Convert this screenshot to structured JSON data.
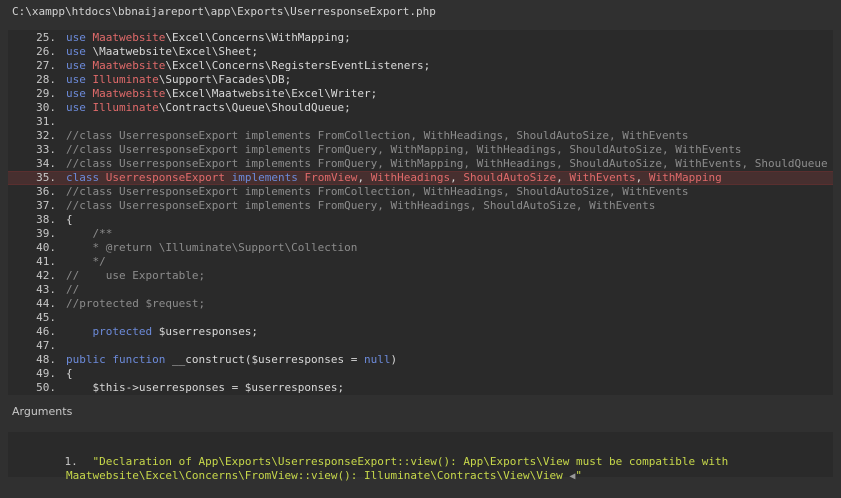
{
  "file_path": "C:\\xampp\\htdocs\\bbnaijareport\\app\\Exports\\UserresponseExport.php",
  "arguments_label": "Arguments",
  "code_lines": [
    {
      "n": "25.",
      "hl": false,
      "t": [
        [
          "k",
          "use "
        ],
        [
          "r",
          "Maatwebsite"
        ],
        [
          "w",
          "\\Excel\\Concerns\\WithMapping;"
        ]
      ]
    },
    {
      "n": "26.",
      "hl": false,
      "t": [
        [
          "k",
          "use "
        ],
        [
          "w",
          "\\Maatwebsite\\Excel\\Sheet;"
        ]
      ]
    },
    {
      "n": "27.",
      "hl": false,
      "t": [
        [
          "k",
          "use "
        ],
        [
          "r",
          "Maatwebsite"
        ],
        [
          "w",
          "\\Excel\\Concerns\\RegistersEventListeners;"
        ]
      ]
    },
    {
      "n": "28.",
      "hl": false,
      "t": [
        [
          "k",
          "use "
        ],
        [
          "r",
          "Illuminate"
        ],
        [
          "w",
          "\\Support\\Facades\\DB;"
        ]
      ]
    },
    {
      "n": "29.",
      "hl": false,
      "t": [
        [
          "k",
          "use "
        ],
        [
          "r",
          "Maatwebsite"
        ],
        [
          "w",
          "\\Excel\\Maatwebsite\\Excel\\Writer;"
        ]
      ]
    },
    {
      "n": "30.",
      "hl": false,
      "t": [
        [
          "k",
          "use "
        ],
        [
          "r",
          "Illuminate"
        ],
        [
          "w",
          "\\Contracts\\Queue\\ShouldQueue;"
        ]
      ]
    },
    {
      "n": "31.",
      "hl": false,
      "t": []
    },
    {
      "n": "32.",
      "hl": false,
      "t": [
        [
          "c",
          "//class UserresponseExport implements FromCollection, WithHeadings, ShouldAutoSize, WithEvents"
        ]
      ]
    },
    {
      "n": "33.",
      "hl": false,
      "t": [
        [
          "c",
          "//class UserresponseExport implements FromQuery, WithMapping, WithHeadings, ShouldAutoSize, WithEvents"
        ]
      ]
    },
    {
      "n": "34.",
      "hl": false,
      "t": [
        [
          "c",
          "//class UserresponseExport implements FromQuery, WithMapping, WithHeadings, ShouldAutoSize, WithEvents, ShouldQueue"
        ]
      ]
    },
    {
      "n": "35.",
      "hl": true,
      "t": [
        [
          "k",
          "class "
        ],
        [
          "r",
          "UserresponseExport "
        ],
        [
          "k",
          "implements "
        ],
        [
          "r",
          "FromView"
        ],
        [
          "w",
          ", "
        ],
        [
          "r",
          "WithHeadings"
        ],
        [
          "w",
          ", "
        ],
        [
          "r",
          "ShouldAutoSize"
        ],
        [
          "w",
          ", "
        ],
        [
          "r",
          "WithEvents"
        ],
        [
          "w",
          ", "
        ],
        [
          "r",
          "WithMapping"
        ]
      ]
    },
    {
      "n": "36.",
      "hl": false,
      "t": [
        [
          "c",
          "//class UserresponseExport implements FromCollection, WithHeadings, ShouldAutoSize, WithEvents"
        ]
      ]
    },
    {
      "n": "37.",
      "hl": false,
      "t": [
        [
          "c",
          "//class UserresponseExport implements FromQuery, WithHeadings, ShouldAutoSize, WithEvents"
        ]
      ]
    },
    {
      "n": "38.",
      "hl": false,
      "t": [
        [
          "w",
          "{"
        ]
      ]
    },
    {
      "n": "39.",
      "hl": false,
      "t": [
        [
          "c",
          "    /**"
        ]
      ]
    },
    {
      "n": "40.",
      "hl": false,
      "t": [
        [
          "c",
          "    * @return \\Illuminate\\Support\\Collection"
        ]
      ]
    },
    {
      "n": "41.",
      "hl": false,
      "t": [
        [
          "c",
          "    */"
        ]
      ]
    },
    {
      "n": "42.",
      "hl": false,
      "t": [
        [
          "c",
          "//    use Exportable;"
        ]
      ]
    },
    {
      "n": "43.",
      "hl": false,
      "t": [
        [
          "c",
          "//"
        ]
      ]
    },
    {
      "n": "44.",
      "hl": false,
      "t": [
        [
          "c",
          "//protected $request;"
        ]
      ]
    },
    {
      "n": "45.",
      "hl": false,
      "t": []
    },
    {
      "n": "46.",
      "hl": false,
      "t": [
        [
          "k",
          "    protected "
        ],
        [
          "w",
          "$userresponses;"
        ]
      ]
    },
    {
      "n": "47.",
      "hl": false,
      "t": []
    },
    {
      "n": "48.",
      "hl": false,
      "t": [
        [
          "k",
          "public "
        ],
        [
          "k",
          "function "
        ],
        [
          "w",
          "__construct($userresponses = "
        ],
        [
          "k",
          "null"
        ],
        [
          "w",
          ")"
        ]
      ]
    },
    {
      "n": "49.",
      "hl": false,
      "t": [
        [
          "w",
          "{"
        ]
      ]
    },
    {
      "n": "50.",
      "hl": false,
      "t": [
        [
          "w",
          "    $this->userresponses = $userresponses;"
        ]
      ]
    }
  ],
  "arguments": [
    {
      "number": "1.",
      "line1": "\"Declaration of App\\Exports\\UserresponseExport::view(): App\\Exports\\View must be compatible with",
      "line2": "Maatwebsite\\Excel\\Concerns\\FromView::view(): Illuminate\\Contracts\\View\\View ",
      "end_quote": "\""
    }
  ],
  "icons": {
    "arrow": "left-arrow-icon"
  },
  "colors": {
    "keyword": "#6c8ad9",
    "class_name": "#e06a6a",
    "comment": "#8c8c8c",
    "argument": "#c7d84a",
    "highlight_bg": "#472f2f"
  }
}
